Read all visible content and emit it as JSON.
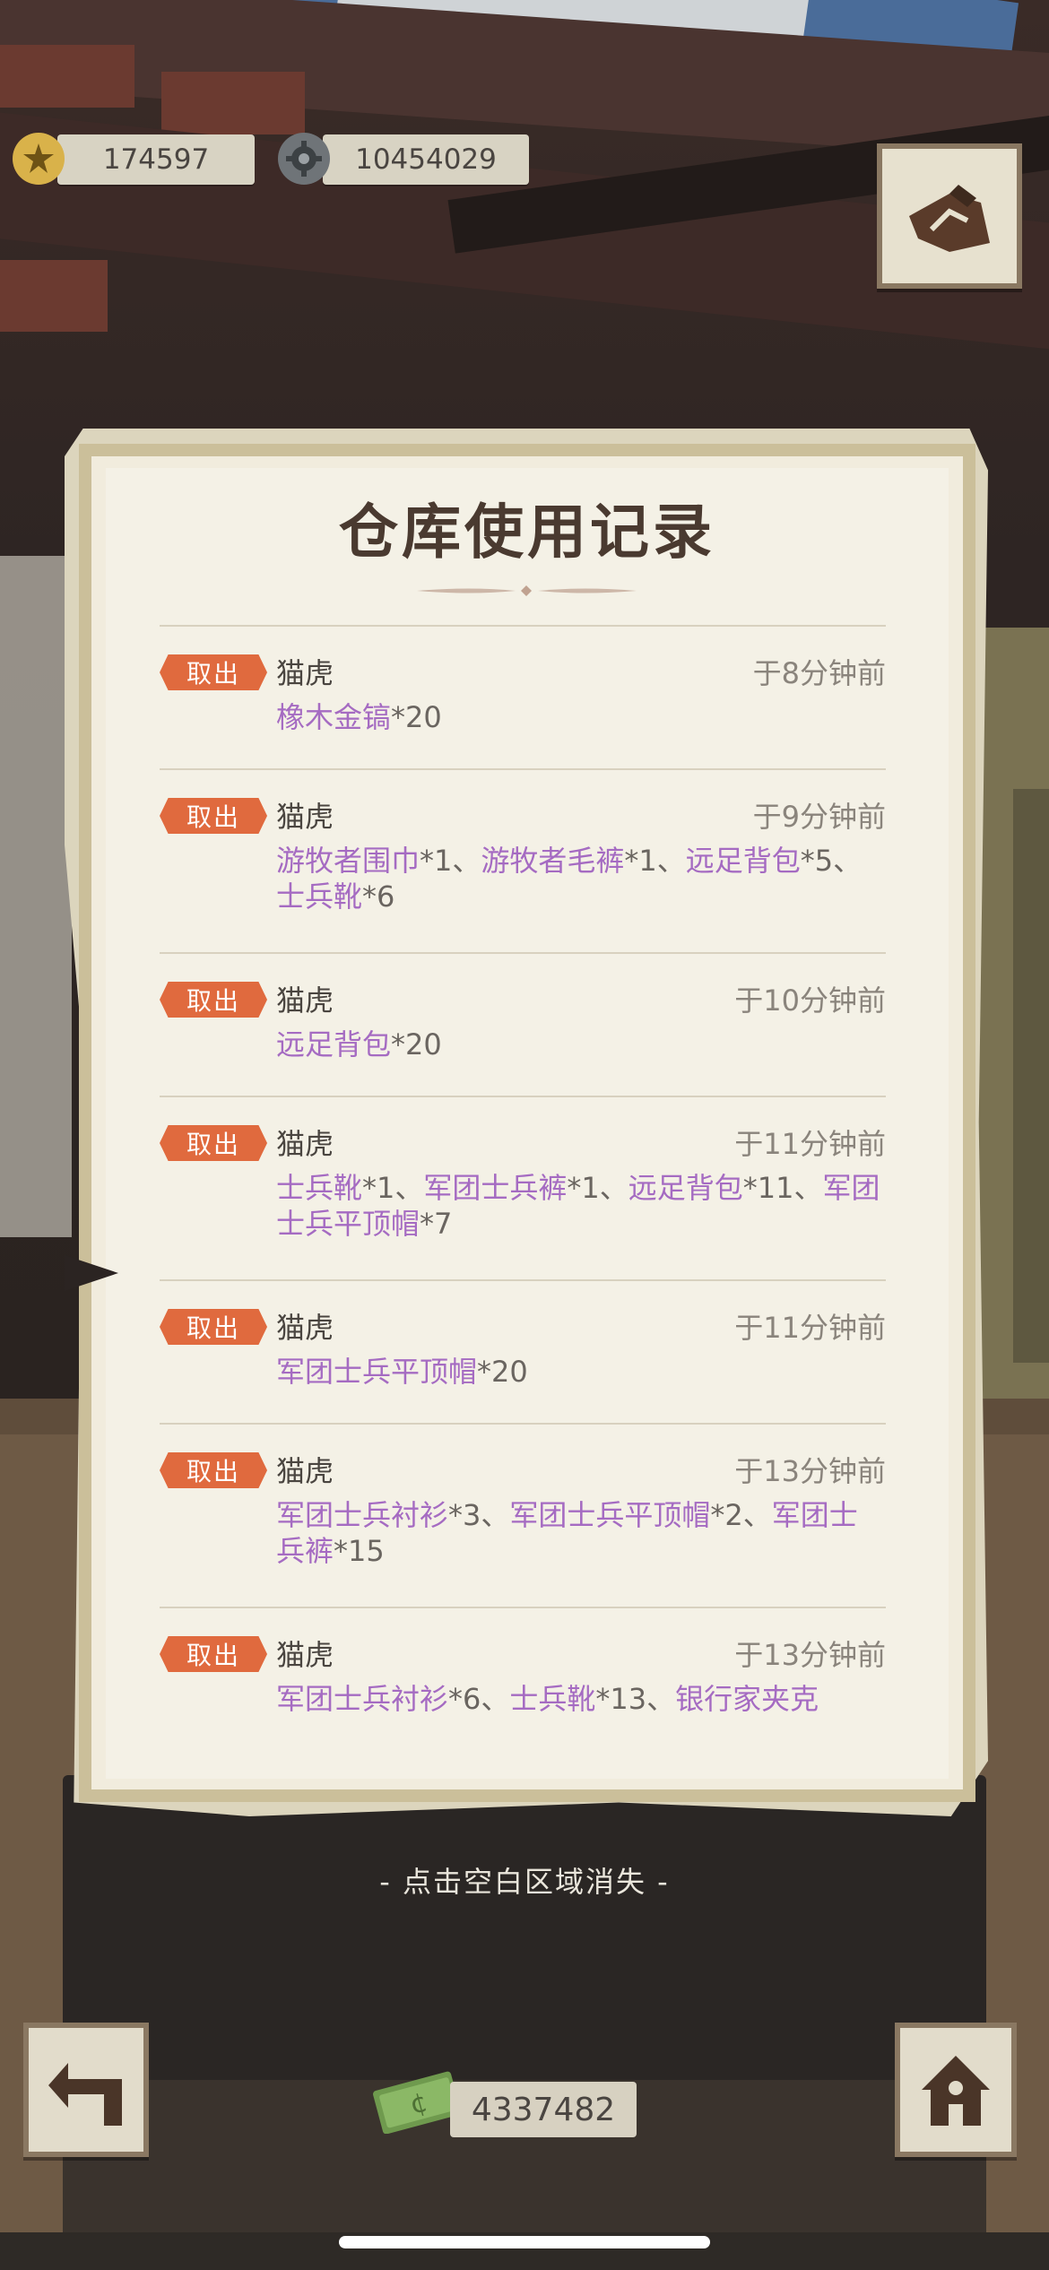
{
  "top_bar": {
    "badges": "174597",
    "gears": "10454029"
  },
  "panel": {
    "title": "仓库使用记录",
    "entries": [
      {
        "tag": "取出",
        "user": "猫虎",
        "time": "于8分钟前",
        "items": [
          {
            "name": "橡木金镐",
            "qty": "*20"
          }
        ]
      },
      {
        "tag": "取出",
        "user": "猫虎",
        "time": "于9分钟前",
        "items": [
          {
            "name": "游牧者围巾",
            "qty": "*1、"
          },
          {
            "name": "游牧者毛裤",
            "qty": "*1、"
          },
          {
            "name": "远足背包",
            "qty": "*5、"
          },
          {
            "name": "士兵靴",
            "qty": "*6"
          }
        ]
      },
      {
        "tag": "取出",
        "user": "猫虎",
        "time": "于10分钟前",
        "items": [
          {
            "name": "远足背包",
            "qty": "*20"
          }
        ]
      },
      {
        "tag": "取出",
        "user": "猫虎",
        "time": "于11分钟前",
        "items": [
          {
            "name": "士兵靴",
            "qty": "*1、"
          },
          {
            "name": "军团士兵裤",
            "qty": "*1、"
          },
          {
            "name": "远足背包",
            "qty": "*11、"
          },
          {
            "name": "军团士兵平顶帽",
            "qty": "*7"
          }
        ]
      },
      {
        "tag": "取出",
        "user": "猫虎",
        "time": "于11分钟前",
        "items": [
          {
            "name": "军团士兵平顶帽",
            "qty": "*20"
          }
        ]
      },
      {
        "tag": "取出",
        "user": "猫虎",
        "time": "于13分钟前",
        "items": [
          {
            "name": "军团士兵衬衫",
            "qty": "*3、"
          },
          {
            "name": "军团士兵平顶帽",
            "qty": "*2、"
          },
          {
            "name": "军团士兵裤",
            "qty": "*15"
          }
        ]
      },
      {
        "tag": "取出",
        "user": "猫虎",
        "time": "于13分钟前",
        "items": [
          {
            "name": "军团士兵衬衫",
            "qty": "*6、"
          },
          {
            "name": "士兵靴",
            "qty": "*13、"
          },
          {
            "name": "银行家夹克",
            "qty": ""
          }
        ]
      }
    ],
    "dismiss_hint": "- 点击空白区域消失 -"
  },
  "bottom_bar": {
    "cash": "4337482"
  },
  "icons": {
    "badge": "medal-icon",
    "gear": "gear-icon",
    "top_button": "map-icon",
    "back": "back-arrow-icon",
    "home": "house-icon",
    "cash": "banknote-icon"
  },
  "colors": {
    "tag_bg": "#e06a3e",
    "item_name": "#a56bc2",
    "paper": "#f4f1e6"
  }
}
